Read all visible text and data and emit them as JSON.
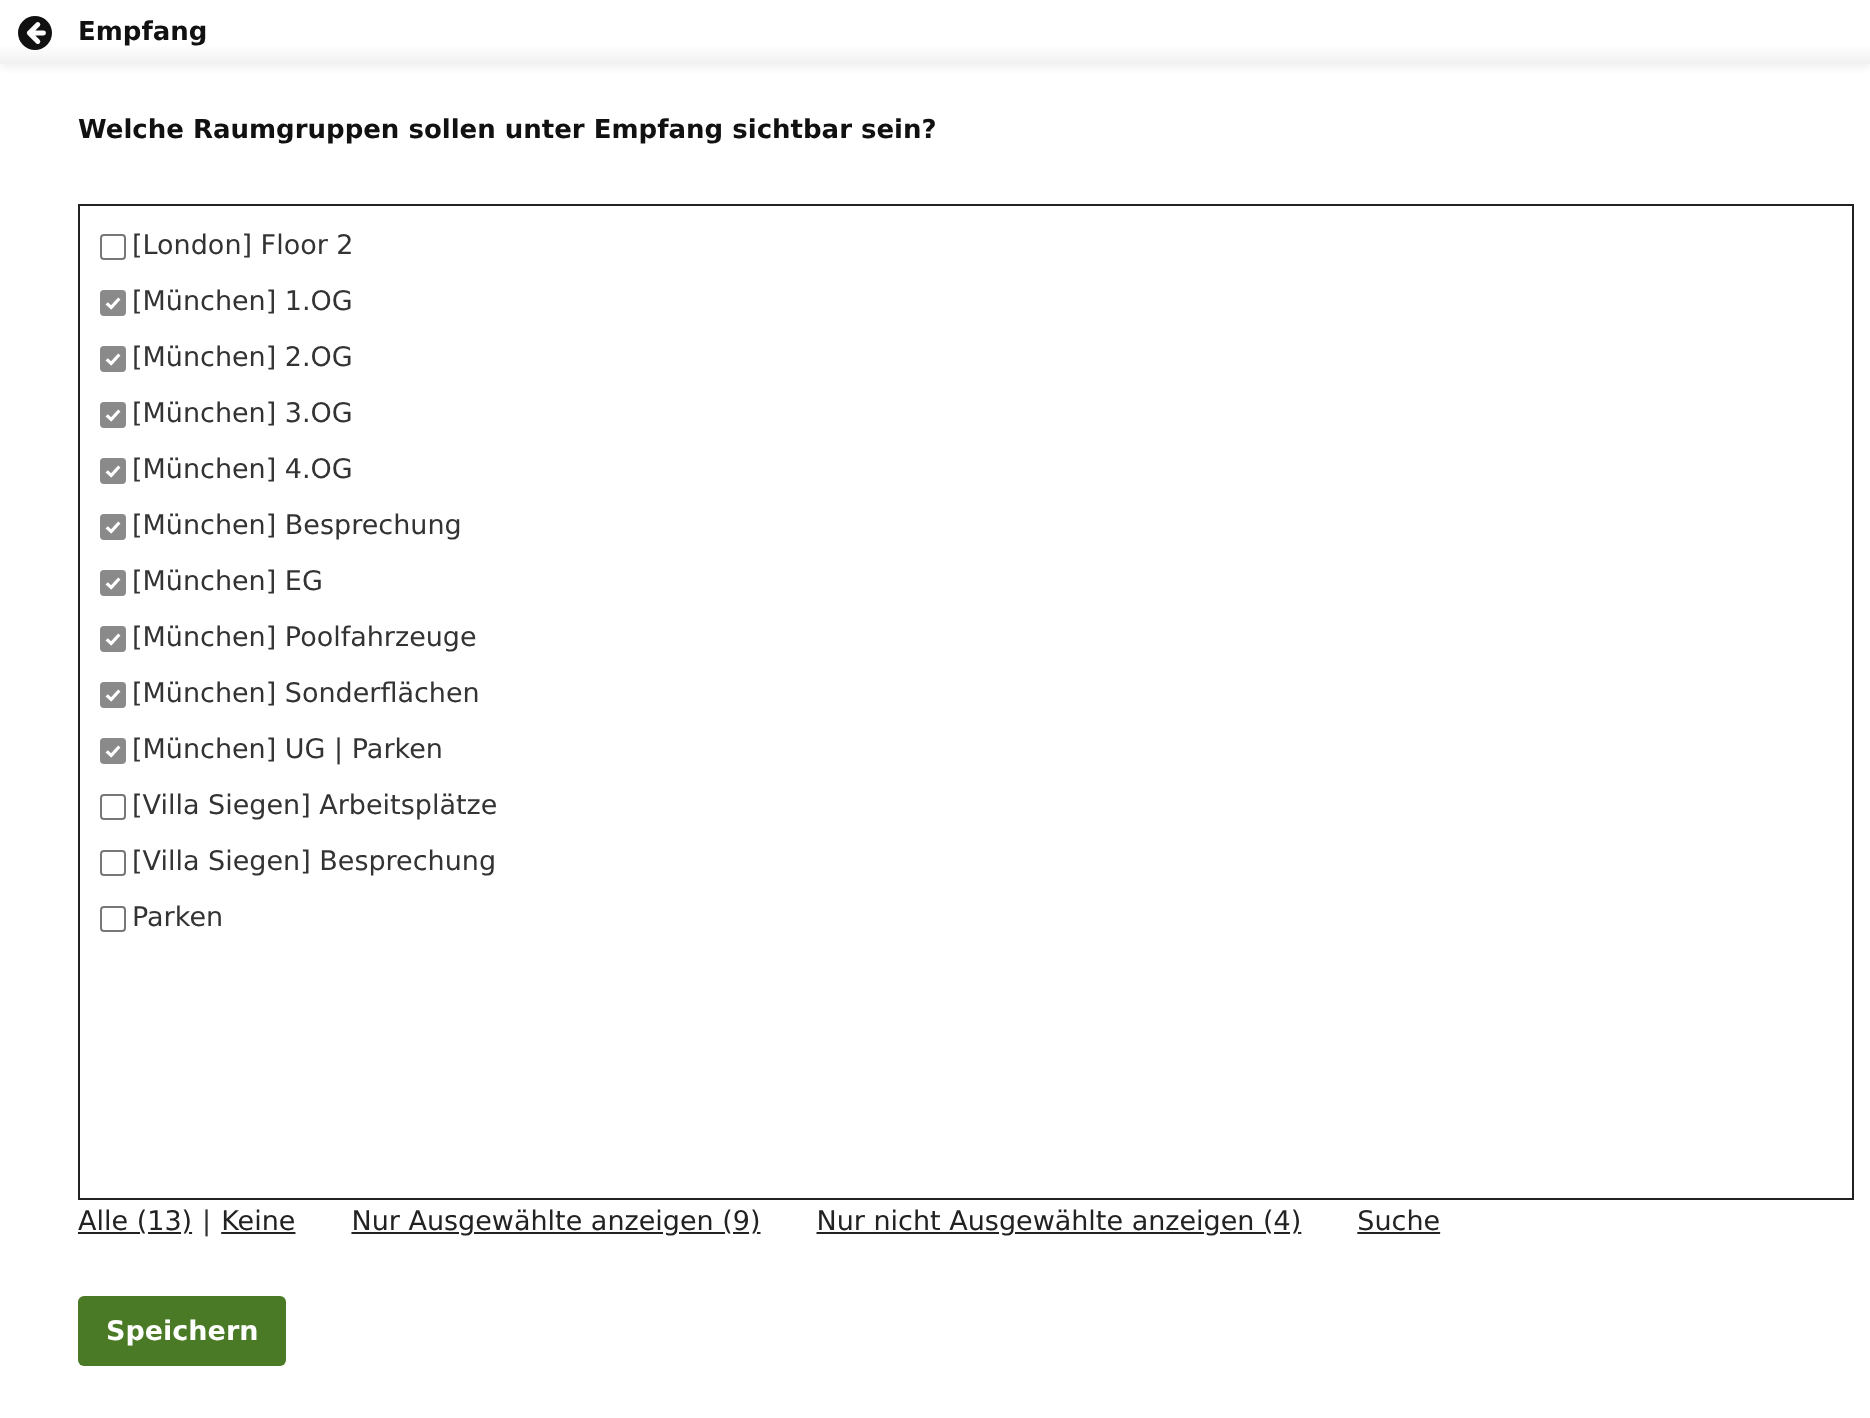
{
  "header": {
    "title": "Empfang"
  },
  "question": "Welche Raumgruppen sollen unter Empfang sichtbar sein?",
  "room_groups": [
    {
      "label": "[London] Floor 2",
      "checked": false
    },
    {
      "label": "[München] 1.OG",
      "checked": true
    },
    {
      "label": "[München] 2.OG",
      "checked": true
    },
    {
      "label": "[München] 3.OG",
      "checked": true
    },
    {
      "label": "[München] 4.OG",
      "checked": true
    },
    {
      "label": "[München] Besprechung",
      "checked": true
    },
    {
      "label": "[München] EG",
      "checked": true
    },
    {
      "label": "[München] Poolfahrzeuge",
      "checked": true
    },
    {
      "label": "[München] Sonderflächen",
      "checked": true
    },
    {
      "label": "[München] UG | Parken",
      "checked": true
    },
    {
      "label": "[Villa Siegen] Arbeitsplätze",
      "checked": false
    },
    {
      "label": "[Villa Siegen] Besprechung",
      "checked": false
    },
    {
      "label": "Parken",
      "checked": false
    }
  ],
  "link_bar": {
    "all": "Alle (13)",
    "separator": "|",
    "none": "Keine",
    "show_selected": "Nur Ausgewählte anzeigen (9)",
    "show_unselected": "Nur nicht Ausgewählte anzeigen (4)",
    "search": "Suche"
  },
  "save_button": "Speichern"
}
